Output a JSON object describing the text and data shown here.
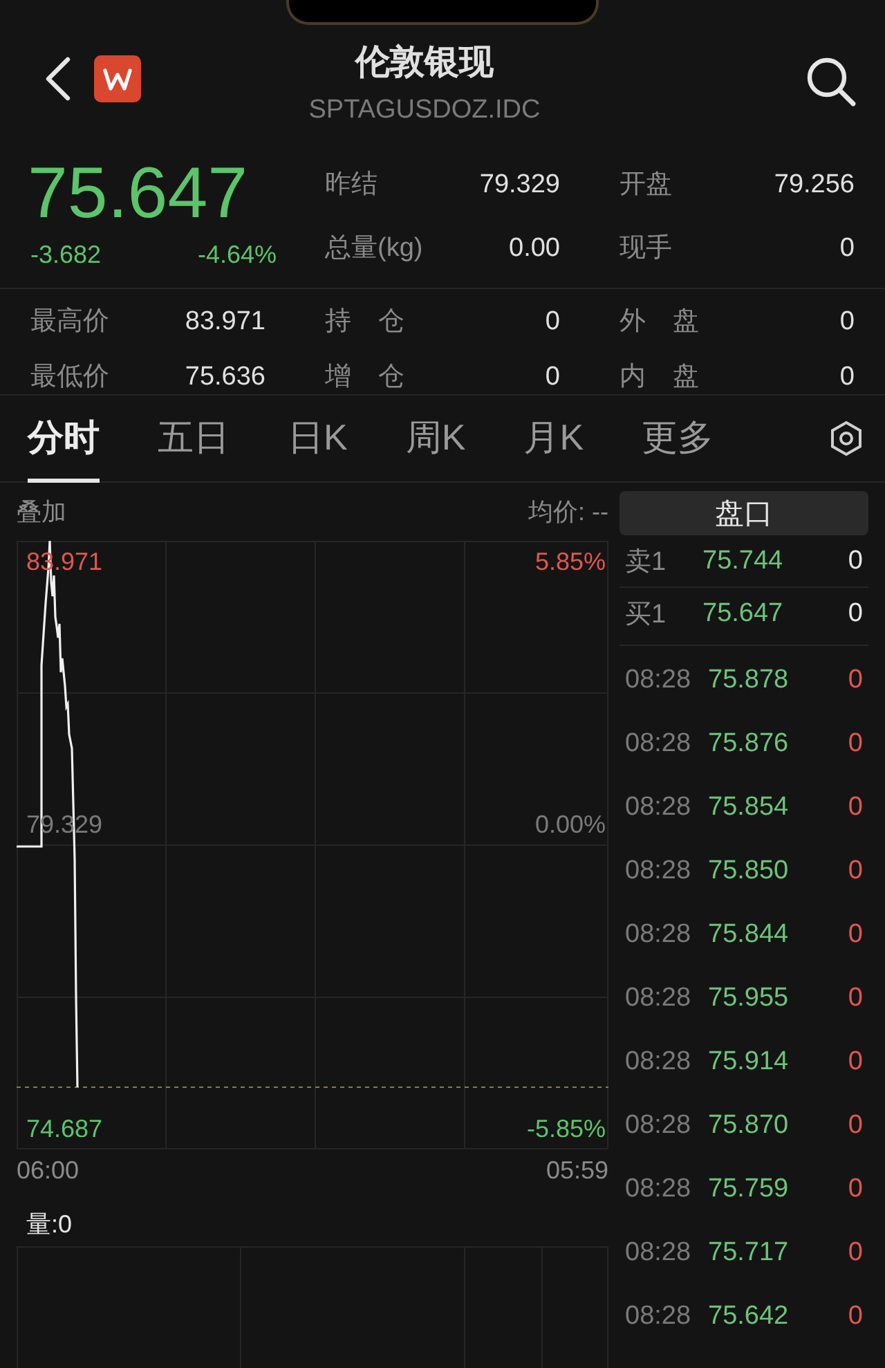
{
  "header": {
    "title": "伦敦银现",
    "code": "SPTAGUSDOZ.IDC"
  },
  "quote": {
    "price": "75.647",
    "change": "-3.682",
    "change_pct": "-4.64%",
    "down": true,
    "stats_top": [
      {
        "label": "昨结",
        "value": "79.329"
      },
      {
        "label": "开盘",
        "value": "79.256"
      },
      {
        "label": "总量(kg)",
        "value": "0.00"
      },
      {
        "label": "现手",
        "value": "0"
      }
    ],
    "stats_bottom": [
      {
        "label": "最高价",
        "value": "83.971"
      },
      {
        "label": "持 仓",
        "value": "0"
      },
      {
        "label": "外 盘",
        "value": "0"
      },
      {
        "label": "最低价",
        "value": "75.636"
      },
      {
        "label": "增 仓",
        "value": "0"
      },
      {
        "label": "内 盘",
        "value": "0"
      }
    ]
  },
  "tabs": [
    {
      "label": "分时",
      "selected": true
    },
    {
      "label": "五日",
      "selected": false
    },
    {
      "label": "日K",
      "selected": false
    },
    {
      "label": "周K",
      "selected": false
    },
    {
      "label": "月K",
      "selected": false
    },
    {
      "label": "更多",
      "selected": false
    }
  ],
  "chart": {
    "overlay_label": "叠加",
    "avg_price": "均价: --",
    "price_high": "83.971",
    "pct_high": "5.85%",
    "price_base": "79.329",
    "pct_base": "0.00%",
    "price_low": "74.687",
    "pct_low": "-5.85%",
    "time_start": "06:00",
    "time_end": "05:59",
    "volume_label": "量:0"
  },
  "order_panel": {
    "title": "盘口",
    "quotes": [
      {
        "label": "卖1",
        "price": "75.744",
        "volume": "0"
      },
      {
        "label": "买1",
        "price": "75.647",
        "volume": "0"
      }
    ],
    "trades": [
      {
        "time": "08:28",
        "price": "75.878",
        "volume": "0"
      },
      {
        "time": "08:28",
        "price": "75.876",
        "volume": "0"
      },
      {
        "time": "08:28",
        "price": "75.854",
        "volume": "0"
      },
      {
        "time": "08:28",
        "price": "75.850",
        "volume": "0"
      },
      {
        "time": "08:28",
        "price": "75.844",
        "volume": "0"
      },
      {
        "time": "08:28",
        "price": "75.955",
        "volume": "0"
      },
      {
        "time": "08:28",
        "price": "75.914",
        "volume": "0"
      },
      {
        "time": "08:28",
        "price": "75.870",
        "volume": "0"
      },
      {
        "time": "08:28",
        "price": "75.759",
        "volume": "0"
      },
      {
        "time": "08:28",
        "price": "75.717",
        "volume": "0"
      },
      {
        "time": "08:28",
        "price": "75.642",
        "volume": "0"
      }
    ]
  }
}
